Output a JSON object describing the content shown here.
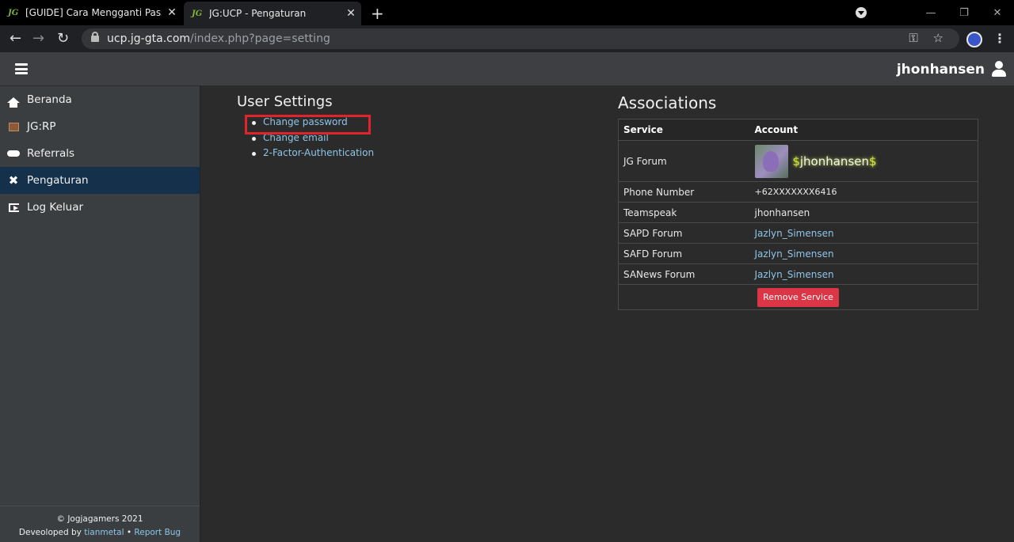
{
  "browser": {
    "tabs": [
      {
        "favicon": "JG",
        "title": "[GUIDE] Cara Mengganti Passwo",
        "active": false
      },
      {
        "favicon": "JG",
        "title": "JG:UCP - Pengaturan",
        "active": true
      }
    ],
    "url_host": "ucp.jg-gta.com",
    "url_path": "/index.php?page=setting",
    "icons": [
      "back-icon",
      "forward-icon",
      "reload-icon",
      "lock-icon",
      "key-icon",
      "star-icon",
      "avatar",
      "menu-dots-icon"
    ]
  },
  "header": {
    "username": "jhonhansen"
  },
  "sidebar": {
    "items": [
      {
        "label": "Beranda",
        "icon": "home-icon",
        "active": false
      },
      {
        "label": "JG:RP",
        "icon": "jgrp-icon",
        "active": false
      },
      {
        "label": "Referrals",
        "icon": "handshake-icon",
        "active": false
      },
      {
        "label": "Pengaturan",
        "icon": "tools-icon",
        "active": true
      },
      {
        "label": "Log Keluar",
        "icon": "logout-icon",
        "active": false
      }
    ],
    "footer": {
      "copyright": "© Jogjagamers 2021",
      "developed_prefix": "Deveoloped by",
      "developer": "tianmetal",
      "separator": "•",
      "report_bug": "Report Bug"
    }
  },
  "user_settings": {
    "title": "User Settings",
    "links": [
      "Change password",
      "Change email",
      "2-Factor-Authentication"
    ]
  },
  "associations": {
    "title": "Associations",
    "columns": [
      "Service",
      "Account"
    ],
    "forum_row": {
      "service": "JG Forum",
      "dollar": "$",
      "name": "jhonhansen"
    },
    "rows": [
      {
        "service": "Phone Number",
        "account": "+62XXXXXXX6416"
      },
      {
        "service": "Teamspeak",
        "account": "jhonhansen"
      },
      {
        "service": "SAPD Forum",
        "account": "Jazlyn_Simensen"
      },
      {
        "service": "SAFD Forum",
        "account": "Jazlyn_Simensen"
      },
      {
        "service": "SANews Forum",
        "account": "Jazlyn_Simensen"
      }
    ],
    "remove_label": "Remove Service"
  },
  "colors": {
    "highlight": "#e0242b",
    "active_sidebar": "#14304a",
    "link": "#8ec5e8",
    "danger": "#dc3545"
  }
}
